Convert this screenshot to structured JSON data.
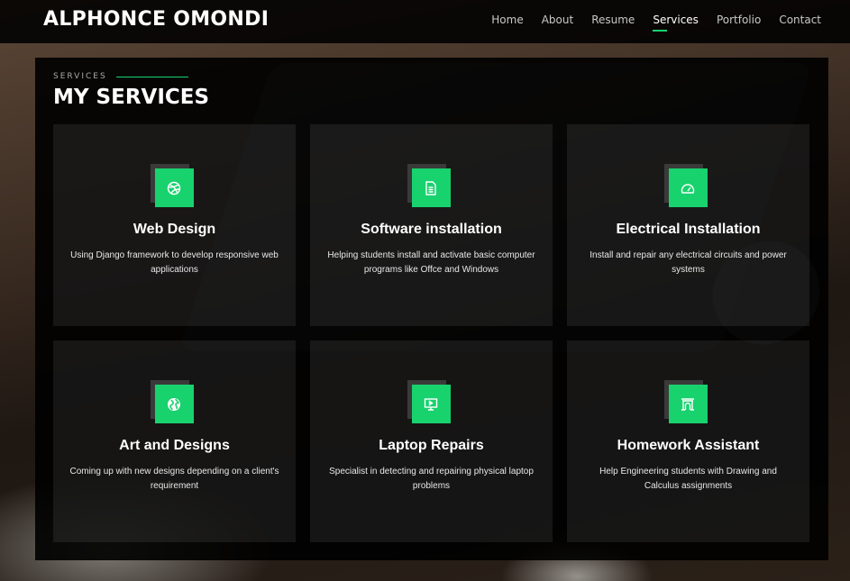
{
  "header": {
    "logo": "ALPHONCE OMONDI",
    "nav": [
      {
        "label": "Home",
        "active": false
      },
      {
        "label": "About",
        "active": false
      },
      {
        "label": "Resume",
        "active": false
      },
      {
        "label": "Services",
        "active": true
      },
      {
        "label": "Portfolio",
        "active": false
      },
      {
        "label": "Contact",
        "active": false
      }
    ]
  },
  "section": {
    "label": "SERVICES",
    "title": "MY SERVICES"
  },
  "services": [
    {
      "icon": "dribbble-icon",
      "title": "Web Design",
      "description": "Using Django framework to develop responsive web applications"
    },
    {
      "icon": "file-icon",
      "title": "Software installation",
      "description": "Helping students install and activate basic computer programs like Offce and Windows"
    },
    {
      "icon": "speedometer-icon",
      "title": "Electrical Installation",
      "description": "Install and repair any electrical circuits and power systems"
    },
    {
      "icon": "globe-icon",
      "title": "Art and Designs",
      "description": "Coming up with new designs depending on a client's requirement"
    },
    {
      "icon": "presentation-icon",
      "title": "Laptop Repairs",
      "description": "Specialist in detecting and repairing physical laptop problems"
    },
    {
      "icon": "arch-icon",
      "title": "Homework Assistant",
      "description": "Help Engineering students with Drawing and Calculus assignments"
    }
  ],
  "colors": {
    "accent": "#18d26e",
    "panel": "#0d0d0d"
  }
}
